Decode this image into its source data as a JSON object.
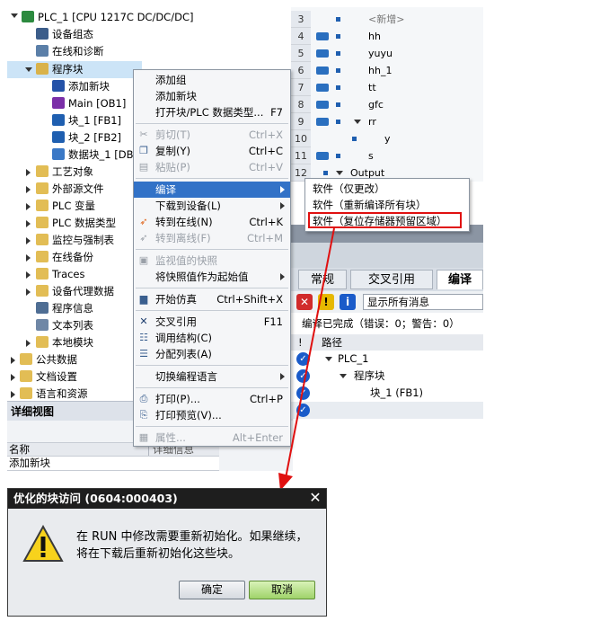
{
  "tree": {
    "items": [
      {
        "label": "PLC_1 [CPU 1217C DC/DC/DC]",
        "icon": "plc-icon"
      },
      {
        "label": "设备组态",
        "icon": "device-config-icon"
      },
      {
        "label": "在线和诊断",
        "icon": "online-diagnostics-icon"
      },
      {
        "label": "程序块",
        "icon": "program-blocks-folder-icon"
      },
      {
        "label": "添加新块",
        "icon": "add-block-icon"
      },
      {
        "label": "Main [OB1]",
        "icon": "ob-icon"
      },
      {
        "label": "块_1 [FB1]",
        "icon": "fb-icon"
      },
      {
        "label": "块_2 [FB2]",
        "icon": "fb-icon"
      },
      {
        "label": "数据块_1 [DB",
        "icon": "db-icon"
      },
      {
        "label": "工艺对象",
        "icon": "folder-icon"
      },
      {
        "label": "外部源文件",
        "icon": "folder-icon"
      },
      {
        "label": "PLC 变量",
        "icon": "folder-icon"
      },
      {
        "label": "PLC 数据类型",
        "icon": "folder-icon"
      },
      {
        "label": "监控与强制表",
        "icon": "folder-icon"
      },
      {
        "label": "在线备份",
        "icon": "folder-icon"
      },
      {
        "label": "Traces",
        "icon": "folder-icon"
      },
      {
        "label": "设备代理数据",
        "icon": "folder-icon"
      },
      {
        "label": "程序信息",
        "icon": "info-icon"
      },
      {
        "label": "文本列表",
        "icon": "text-list-icon"
      },
      {
        "label": "本地模块",
        "icon": "folder-icon"
      },
      {
        "label": "公共数据",
        "icon": "folder-icon"
      },
      {
        "label": "文档设置",
        "icon": "folder-icon"
      },
      {
        "label": "语言和资源",
        "icon": "folder-icon"
      }
    ]
  },
  "detail_view": {
    "title": "详细视图",
    "col_name": "名称",
    "col_detail": "详细信息",
    "row_value": "添加新块"
  },
  "var_table": {
    "rows": [
      {
        "num": "3",
        "name": "<新增>"
      },
      {
        "num": "4",
        "name": "hh"
      },
      {
        "num": "5",
        "name": "yuyu"
      },
      {
        "num": "6",
        "name": "hh_1"
      },
      {
        "num": "7",
        "name": "tt"
      },
      {
        "num": "8",
        "name": "gfc"
      },
      {
        "num": "9",
        "name": "rr"
      },
      {
        "num": "10",
        "name": "y"
      },
      {
        "num": "11",
        "name": "s"
      },
      {
        "num": "12",
        "name": "Output"
      }
    ]
  },
  "context_menu": {
    "items": [
      {
        "label": "添加组",
        "shortcut": ""
      },
      {
        "label": "添加新块",
        "shortcut": ""
      },
      {
        "label": "打开块/PLC 数据类型...",
        "shortcut": "F7"
      },
      {
        "label": "剪切(T)",
        "shortcut": "Ctrl+X"
      },
      {
        "label": "复制(Y)",
        "shortcut": "Ctrl+C"
      },
      {
        "label": "粘贴(P)",
        "shortcut": "Ctrl+V"
      },
      {
        "label": "编译",
        "shortcut": ""
      },
      {
        "label": "下载到设备(L)",
        "shortcut": ""
      },
      {
        "label": "转到在线(N)",
        "shortcut": "Ctrl+K"
      },
      {
        "label": "转到离线(F)",
        "shortcut": "Ctrl+M"
      },
      {
        "label": "监视值的快照",
        "shortcut": ""
      },
      {
        "label": "将快照值作为起始值",
        "shortcut": ""
      },
      {
        "label": "开始仿真",
        "shortcut": "Ctrl+Shift+X"
      },
      {
        "label": "交叉引用",
        "shortcut": "F11"
      },
      {
        "label": "调用结构(C)",
        "shortcut": ""
      },
      {
        "label": "分配列表(A)",
        "shortcut": ""
      },
      {
        "label": "切换编程语言",
        "shortcut": ""
      },
      {
        "label": "打印(P)...",
        "shortcut": "Ctrl+P"
      },
      {
        "label": "打印预览(V)...",
        "shortcut": ""
      },
      {
        "label": "属性...",
        "shortcut": "Alt+Enter"
      }
    ]
  },
  "compile_submenu": {
    "items": [
      {
        "label": "软件（仅更改）"
      },
      {
        "label": "软件（重新编译所有块）"
      },
      {
        "label": "软件（复位存储器预留区域）"
      }
    ]
  },
  "inspector": {
    "tabs": [
      "常规",
      "交叉引用",
      "编译"
    ],
    "filter_value": "显示所有消息",
    "compile_status": "编译已完成（错误：0；警告：0）",
    "col_path": "路径",
    "col_excl": "!",
    "messages": [
      {
        "label": "PLC_1"
      },
      {
        "label": "程序块"
      },
      {
        "label": "块_1 (FB1)"
      },
      {
        "label": ""
      }
    ]
  },
  "dialog": {
    "title": "优化的块访问 (0604:000403)",
    "message": "在 RUN 中修改需要重新初始化。如果继续，将在下载后重新初始化这些块。",
    "ok_label": "确定",
    "cancel_label": "取消",
    "close_label": "✕"
  },
  "colors": {
    "highlight_box": "#e01010",
    "menu_highlight": "#3272c7",
    "siemens_blue": "#1a5bc9"
  }
}
